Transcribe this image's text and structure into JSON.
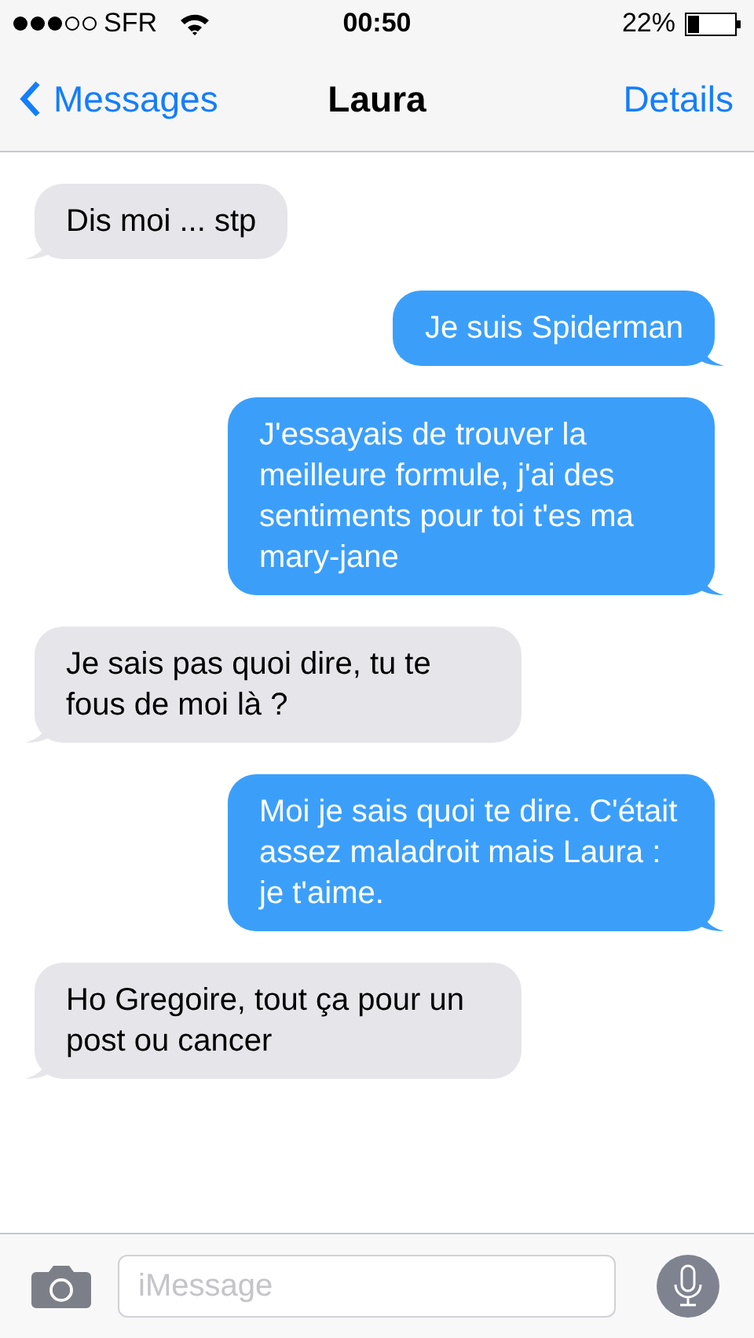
{
  "status_bar": {
    "carrier": "SFR",
    "time": "00:50",
    "battery": "22%"
  },
  "nav_bar": {
    "back": "Messages",
    "title": "Laura",
    "action": "Details"
  },
  "messages": [
    {
      "kind": "incoming",
      "text": "Dis moi ... stp"
    },
    {
      "kind": "outgoing",
      "text": "Je suis Spiderman"
    },
    {
      "kind": "outgoing",
      "text": "J'essayais de trouver la meilleure formule, j'ai des sentiments pour toi t'es ma mary-jane"
    },
    {
      "kind": "incoming",
      "text": "Je sais pas quoi dire, tu te fous de moi là ?"
    },
    {
      "kind": "outgoing",
      "text": "Moi je sais quoi te dire. C'était assez maladroit mais Laura : je t'aime."
    },
    {
      "kind": "incoming",
      "text": "Ho Gregoire, tout ça pour un post ou cancer"
    }
  ],
  "composer": {
    "placeholder": "iMessage"
  }
}
